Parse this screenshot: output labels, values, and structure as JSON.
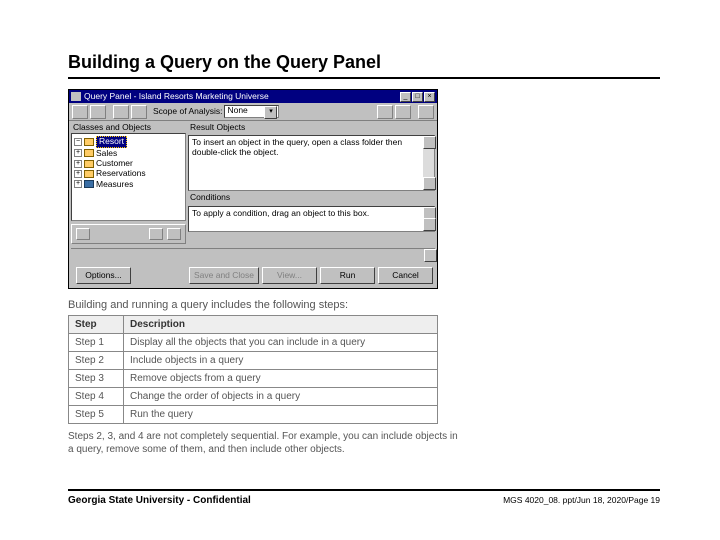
{
  "heading": "Building a Query on the Query Panel",
  "window": {
    "title": "Query Panel - Island Resorts Marketing Universe",
    "toolbar": {
      "scope_label": "Scope of Analysis:",
      "scope_value": "None"
    },
    "classes_label": "Classes and Objects",
    "tree": [
      {
        "label": "Resort",
        "selected": true
      },
      {
        "label": "Sales"
      },
      {
        "label": "Customer"
      },
      {
        "label": "Reservations"
      },
      {
        "label": "Measures"
      }
    ],
    "result_label": "Result Objects",
    "result_hint": "To insert an object in the query, open a class folder then double-click the object.",
    "cond_label": "Conditions",
    "cond_hint": "To apply a condition, drag an object to this box.",
    "buttons": {
      "options": "Options...",
      "save_close": "Save and Close",
      "view": "View...",
      "run": "Run",
      "cancel": "Cancel"
    }
  },
  "steps_intro": "Building and running a query includes the following steps:",
  "steps_headers": {
    "a": "Step",
    "b": "Description"
  },
  "steps": [
    {
      "n": "Step 1",
      "d": "Display all the objects that you can include in a query"
    },
    {
      "n": "Step 2",
      "d": "Include objects in a query"
    },
    {
      "n": "Step 3",
      "d": "Remove objects from a query"
    },
    {
      "n": "Step 4",
      "d": "Change the order of objects in a query"
    },
    {
      "n": "Step 5",
      "d": "Run the query"
    }
  ],
  "steps_note": "Steps 2, 3, and 4 are not completely sequential. For example, you can include objects in a query, remove some of them, and then include other objects.",
  "footer": {
    "left": "Georgia State University - Confidential",
    "right": "MGS 4020_08. ppt/Jun 18, 2020/Page 19"
  }
}
